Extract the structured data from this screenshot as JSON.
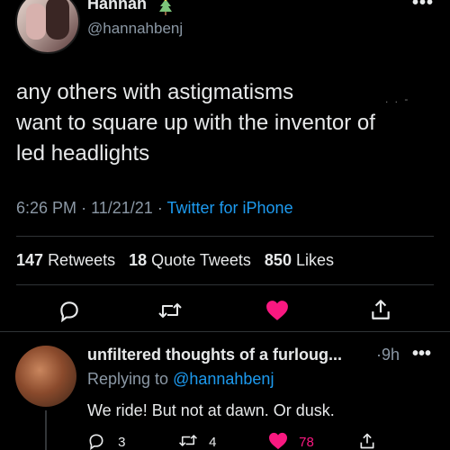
{
  "tweet": {
    "author_name": "Hannah",
    "author_handle": "@hannahbenj",
    "more_label": "•••",
    "text_line1": "any others  with astigmatisms",
    "text_line2": "want to square up with the inventor of",
    "text_line3": "led headlights",
    "time": "6:26 PM",
    "date": "11/21/21",
    "source": "Twitter for iPhone",
    "sep": "·",
    "retweets_count": "147",
    "retweets_label": "Retweets",
    "quotes_count": "18",
    "quotes_label": "Quote Tweets",
    "likes_count": "850",
    "likes_label": "Likes",
    "liked": true
  },
  "reply": {
    "author_name": "unfiltered thoughts of a furloug...",
    "time": "·9h",
    "more_label": "•••",
    "replying_prefix": "Replying to",
    "replying_handle": "@hannahbenj",
    "text": "We ride! But not at dawn. Or dusk.",
    "reply_count": "3",
    "retweet_count": "4",
    "like_count": "78",
    "liked": true
  },
  "colors": {
    "background": "#000000",
    "text": "#e7e9ea",
    "muted": "#8b98a5",
    "link": "#1d9bf0",
    "like": "#f91880",
    "divider": "#2f3336"
  },
  "icons": [
    "christmas-tree-icon",
    "reply-icon",
    "retweet-icon",
    "heart-icon",
    "share-icon"
  ]
}
